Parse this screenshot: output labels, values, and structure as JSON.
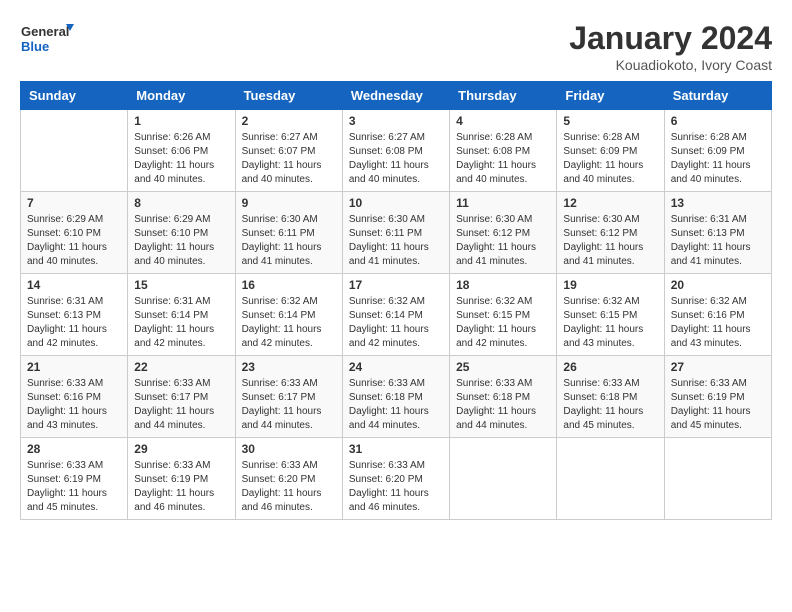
{
  "logo": {
    "text_general": "General",
    "text_blue": "Blue"
  },
  "title": "January 2024",
  "location": "Kouadiokoto, Ivory Coast",
  "weekdays": [
    "Sunday",
    "Monday",
    "Tuesday",
    "Wednesday",
    "Thursday",
    "Friday",
    "Saturday"
  ],
  "weeks": [
    [
      {
        "day": "",
        "info": ""
      },
      {
        "day": "1",
        "info": "Sunrise: 6:26 AM\nSunset: 6:06 PM\nDaylight: 11 hours\nand 40 minutes."
      },
      {
        "day": "2",
        "info": "Sunrise: 6:27 AM\nSunset: 6:07 PM\nDaylight: 11 hours\nand 40 minutes."
      },
      {
        "day": "3",
        "info": "Sunrise: 6:27 AM\nSunset: 6:08 PM\nDaylight: 11 hours\nand 40 minutes."
      },
      {
        "day": "4",
        "info": "Sunrise: 6:28 AM\nSunset: 6:08 PM\nDaylight: 11 hours\nand 40 minutes."
      },
      {
        "day": "5",
        "info": "Sunrise: 6:28 AM\nSunset: 6:09 PM\nDaylight: 11 hours\nand 40 minutes."
      },
      {
        "day": "6",
        "info": "Sunrise: 6:28 AM\nSunset: 6:09 PM\nDaylight: 11 hours\nand 40 minutes."
      }
    ],
    [
      {
        "day": "7",
        "info": "Sunrise: 6:29 AM\nSunset: 6:10 PM\nDaylight: 11 hours\nand 40 minutes."
      },
      {
        "day": "8",
        "info": "Sunrise: 6:29 AM\nSunset: 6:10 PM\nDaylight: 11 hours\nand 40 minutes."
      },
      {
        "day": "9",
        "info": "Sunrise: 6:30 AM\nSunset: 6:11 PM\nDaylight: 11 hours\nand 41 minutes."
      },
      {
        "day": "10",
        "info": "Sunrise: 6:30 AM\nSunset: 6:11 PM\nDaylight: 11 hours\nand 41 minutes."
      },
      {
        "day": "11",
        "info": "Sunrise: 6:30 AM\nSunset: 6:12 PM\nDaylight: 11 hours\nand 41 minutes."
      },
      {
        "day": "12",
        "info": "Sunrise: 6:30 AM\nSunset: 6:12 PM\nDaylight: 11 hours\nand 41 minutes."
      },
      {
        "day": "13",
        "info": "Sunrise: 6:31 AM\nSunset: 6:13 PM\nDaylight: 11 hours\nand 41 minutes."
      }
    ],
    [
      {
        "day": "14",
        "info": "Sunrise: 6:31 AM\nSunset: 6:13 PM\nDaylight: 11 hours\nand 42 minutes."
      },
      {
        "day": "15",
        "info": "Sunrise: 6:31 AM\nSunset: 6:14 PM\nDaylight: 11 hours\nand 42 minutes."
      },
      {
        "day": "16",
        "info": "Sunrise: 6:32 AM\nSunset: 6:14 PM\nDaylight: 11 hours\nand 42 minutes."
      },
      {
        "day": "17",
        "info": "Sunrise: 6:32 AM\nSunset: 6:14 PM\nDaylight: 11 hours\nand 42 minutes."
      },
      {
        "day": "18",
        "info": "Sunrise: 6:32 AM\nSunset: 6:15 PM\nDaylight: 11 hours\nand 42 minutes."
      },
      {
        "day": "19",
        "info": "Sunrise: 6:32 AM\nSunset: 6:15 PM\nDaylight: 11 hours\nand 43 minutes."
      },
      {
        "day": "20",
        "info": "Sunrise: 6:32 AM\nSunset: 6:16 PM\nDaylight: 11 hours\nand 43 minutes."
      }
    ],
    [
      {
        "day": "21",
        "info": "Sunrise: 6:33 AM\nSunset: 6:16 PM\nDaylight: 11 hours\nand 43 minutes."
      },
      {
        "day": "22",
        "info": "Sunrise: 6:33 AM\nSunset: 6:17 PM\nDaylight: 11 hours\nand 44 minutes."
      },
      {
        "day": "23",
        "info": "Sunrise: 6:33 AM\nSunset: 6:17 PM\nDaylight: 11 hours\nand 44 minutes."
      },
      {
        "day": "24",
        "info": "Sunrise: 6:33 AM\nSunset: 6:18 PM\nDaylight: 11 hours\nand 44 minutes."
      },
      {
        "day": "25",
        "info": "Sunrise: 6:33 AM\nSunset: 6:18 PM\nDaylight: 11 hours\nand 44 minutes."
      },
      {
        "day": "26",
        "info": "Sunrise: 6:33 AM\nSunset: 6:18 PM\nDaylight: 11 hours\nand 45 minutes."
      },
      {
        "day": "27",
        "info": "Sunrise: 6:33 AM\nSunset: 6:19 PM\nDaylight: 11 hours\nand 45 minutes."
      }
    ],
    [
      {
        "day": "28",
        "info": "Sunrise: 6:33 AM\nSunset: 6:19 PM\nDaylight: 11 hours\nand 45 minutes."
      },
      {
        "day": "29",
        "info": "Sunrise: 6:33 AM\nSunset: 6:19 PM\nDaylight: 11 hours\nand 46 minutes."
      },
      {
        "day": "30",
        "info": "Sunrise: 6:33 AM\nSunset: 6:20 PM\nDaylight: 11 hours\nand 46 minutes."
      },
      {
        "day": "31",
        "info": "Sunrise: 6:33 AM\nSunset: 6:20 PM\nDaylight: 11 hours\nand 46 minutes."
      },
      {
        "day": "",
        "info": ""
      },
      {
        "day": "",
        "info": ""
      },
      {
        "day": "",
        "info": ""
      }
    ]
  ]
}
